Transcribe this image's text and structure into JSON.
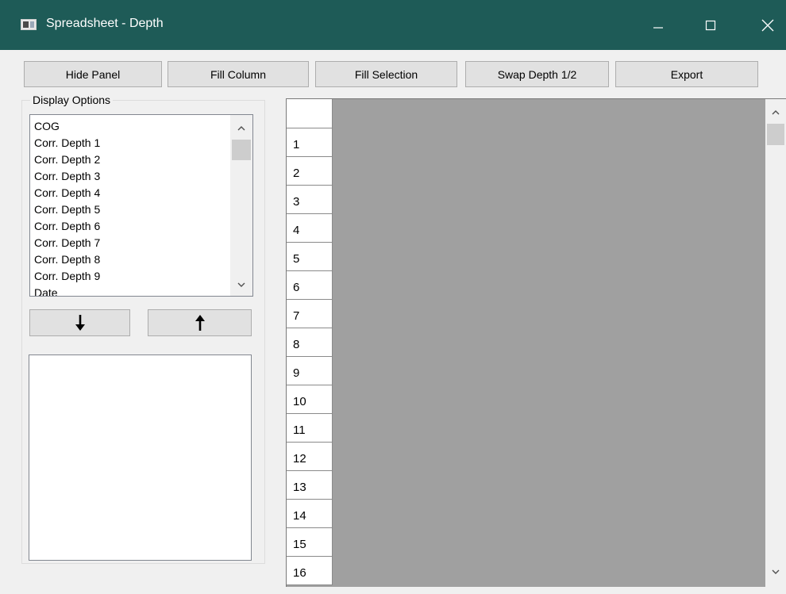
{
  "window": {
    "title": "Spreadsheet - Depth",
    "accent_color": "#1e5b57",
    "controls": [
      "minimize-icon",
      "maximize-icon",
      "close-icon"
    ]
  },
  "toolbar": {
    "hide_panel": "Hide Panel",
    "fill_column": "Fill Column",
    "fill_selection": "Fill Selection",
    "swap_depth": "Swap Depth 1/2",
    "export": "Export"
  },
  "display_options": {
    "label": "Display Options",
    "items": [
      "COG",
      "Corr. Depth 1",
      "Corr. Depth 2",
      "Corr. Depth 3",
      "Corr. Depth 4",
      "Corr. Depth 5",
      "Corr. Depth 6",
      "Corr. Depth 7",
      "Corr. Depth 8",
      "Corr. Depth 9",
      "Date"
    ]
  },
  "move_buttons": {
    "down_icon": "arrow-down-icon",
    "up_icon": "arrow-up-icon"
  },
  "grid": {
    "rows": [
      "1",
      "2",
      "3",
      "4",
      "5",
      "6",
      "7",
      "8",
      "9",
      "10",
      "11",
      "12",
      "13",
      "14",
      "15",
      "16"
    ]
  }
}
